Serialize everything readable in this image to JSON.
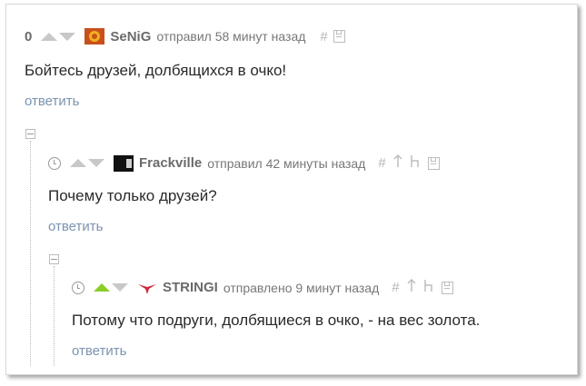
{
  "comments": [
    {
      "rating": "0",
      "username": "SeNiG",
      "meta": "отправил 58 минут назад",
      "hash": "#",
      "text": "Бойтесь друзей, долбящихся в очко!",
      "reply": "ответить"
    },
    {
      "username": "Frackville",
      "meta": "отправил 42 минуты назад",
      "hash": "#",
      "text": "Почему только друзей?",
      "reply": "ответить"
    },
    {
      "username": "STRINGI",
      "meta": "отправлено 9 минут назад",
      "hash": "#",
      "text": "Потому что подруги, долбящиеся в очко, - на вес золота.",
      "reply": "ответить"
    }
  ],
  "icons": {
    "up": "arrow-up-icon",
    "down": "arrow-down-icon",
    "save": "save-icon",
    "parent": "parent-arrow-icon",
    "branch": "branch-icon",
    "clock": "clock-icon",
    "collapse": "collapse-icon"
  },
  "colors": {
    "upvote_active": "#8ccd28",
    "reply_link": "#7b93b0",
    "stringi_logo": "#d0283a"
  }
}
